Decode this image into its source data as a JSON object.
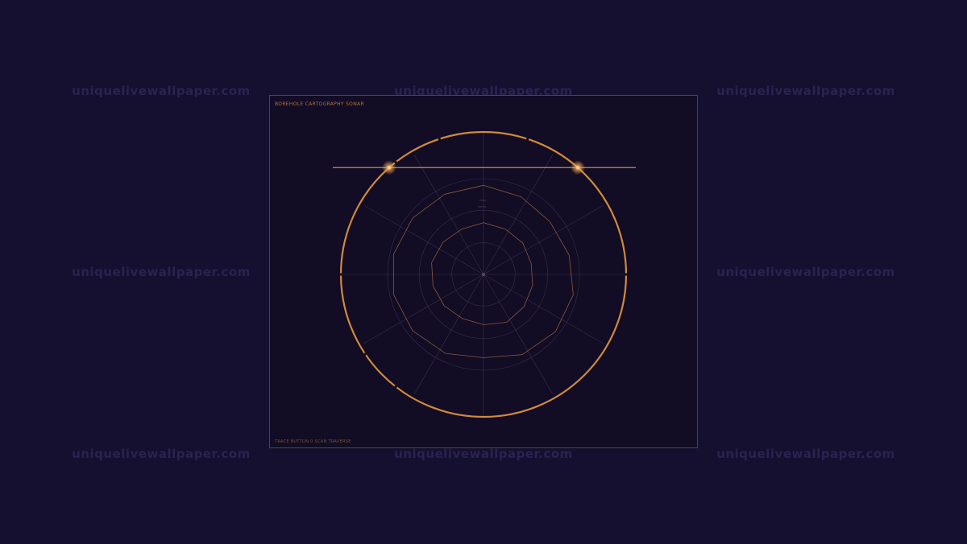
{
  "watermark": "uniquelivewallpaper.com",
  "panel": {
    "title": "BOREHOLE CARTOGRAPHY SONAR",
    "footer": "TRACE BUTTON 0 SCAN TRAVERSE",
    "inner_label_1": "ECHO",
    "inner_label_2": "DEPTH"
  },
  "colors": {
    "page_background": "#150f30",
    "panel_background": "#120c24",
    "panel_border": "#5a4330",
    "accent": "#d08a3c",
    "grid": "#3a3050",
    "contour": "#8a5a3a",
    "glow": "#ffd08a"
  },
  "sonar": {
    "spokes": 12,
    "grid_ring_fractions": [
      0.33,
      0.67,
      1.0
    ],
    "scan_line_depth_fraction": 0.75,
    "outer_ring_gap_angles_deg": [
      -108,
      -72,
      180,
      0,
      128,
      146,
      232
    ],
    "outer_contour": [
      0.62,
      0.6,
      0.59,
      0.61,
      0.64,
      0.64,
      0.62,
      0.58,
      0.61,
      0.63,
      0.64,
      0.64,
      0.63,
      0.62
    ],
    "inner_contour": [
      0.36,
      0.35,
      0.35,
      0.34,
      0.35,
      0.36,
      0.37,
      0.35,
      0.34,
      0.35,
      0.36,
      0.37,
      0.36,
      0.35
    ]
  }
}
